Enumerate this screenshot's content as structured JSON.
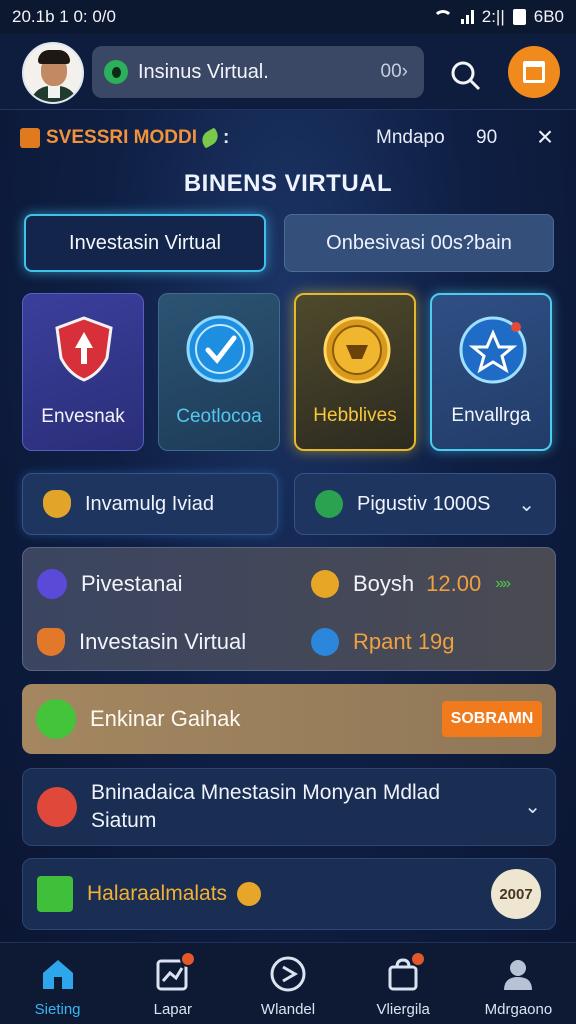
{
  "status_bar": {
    "time": "20.1b 1 0: 0/0",
    "signal_text": "2:||",
    "battery_text": "6B0"
  },
  "header": {
    "search_pill": {
      "label": "Insinus Virtual.",
      "value": "00›"
    }
  },
  "context": {
    "label": "SVESSRI MODDI",
    "suffix": ":",
    "mode": "Mndapo",
    "number": "90",
    "close": "×"
  },
  "page_title": "BINENS VIRTUAL",
  "tabs": [
    {
      "label": "Investasin Virtual",
      "active": true
    },
    {
      "label": "Onbesivasi 00s?bain",
      "active": false
    }
  ],
  "features": [
    {
      "label": "Envesnak",
      "icon": "shield-icon"
    },
    {
      "label": "Ceotlocoa",
      "icon": "check-icon"
    },
    {
      "label": "Hebblives",
      "icon": "gold-coin-icon"
    },
    {
      "label": "Envallrga",
      "icon": "star-icon"
    }
  ],
  "row": {
    "left": {
      "label": "Invamulg Iviad",
      "icon": "shield-small-icon"
    },
    "right": {
      "label": "Pigustiv 1000S",
      "chevron": "⌄",
      "icon": "refresh-icon"
    }
  },
  "panel": {
    "row1_left": "Pivestanai",
    "row1_right_label": "Boysh",
    "row1_amount": "12.00",
    "row1_arrows": "»»",
    "row2_left": "Investasin Virtual",
    "row2_right": "Rpant 19g"
  },
  "promo": {
    "label": "Enkinar Gaihak",
    "button": "SOBRAMN"
  },
  "info": {
    "text": "Bninadaica Mnestasin Monyan Mdlad Siatum",
    "chevron": "⌄"
  },
  "bottom_card": {
    "label": "Halaraalmalats",
    "badge": "2007"
  },
  "nav": [
    {
      "label": "Sieting",
      "icon": "home-icon",
      "active": true
    },
    {
      "label": "Lapar",
      "icon": "chart-icon",
      "active": false
    },
    {
      "label": "Wlandel",
      "icon": "compass-icon",
      "active": false
    },
    {
      "label": "Vliergila",
      "icon": "bag-icon",
      "active": false
    },
    {
      "label": "Mdrgaono",
      "icon": "profile-icon",
      "active": false
    }
  ],
  "colors": {
    "accent": "#3fc1ee",
    "orange": "#f08a1d",
    "gold": "#e5b92b",
    "bg": "#0f1f44"
  }
}
